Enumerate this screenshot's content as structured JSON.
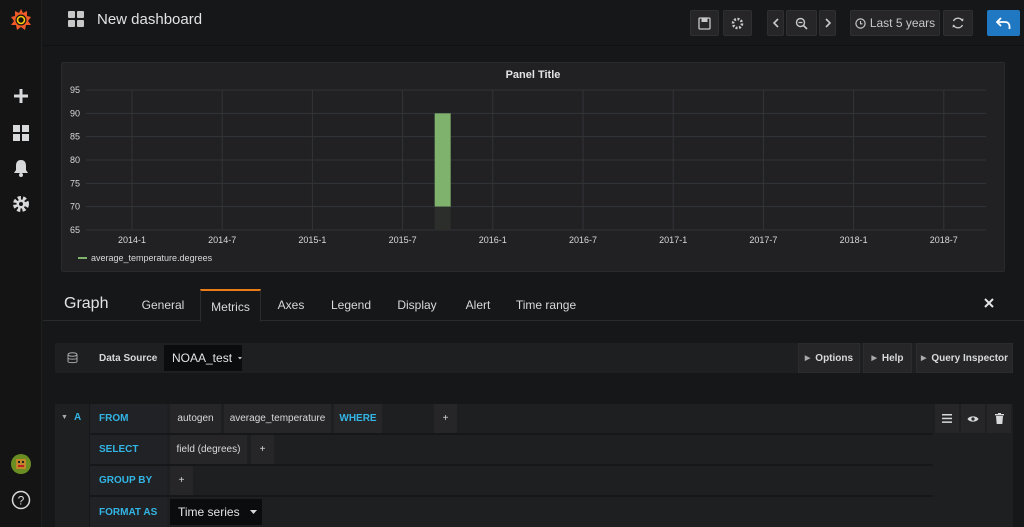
{
  "dashboard": {
    "title": "New dashboard"
  },
  "topbar": {
    "time_range": "Last 5 years"
  },
  "panel": {
    "title": "Panel Title",
    "legend": "average_temperature.degrees"
  },
  "chart_data": {
    "type": "bar",
    "title": "Panel Title",
    "x_ticks": [
      "2014-1",
      "2014-7",
      "2015-1",
      "2015-7",
      "2016-1",
      "2016-7",
      "2017-1",
      "2017-7",
      "2018-1",
      "2018-7"
    ],
    "y_ticks": [
      65,
      70,
      75,
      80,
      85,
      90,
      95
    ],
    "ylim": [
      65,
      95
    ],
    "series": [
      {
        "name": "average_temperature.degrees",
        "x": [
          "2015-09"
        ],
        "values": [
          90
        ]
      }
    ],
    "grid": true,
    "legend_position": "bottom-left",
    "series_color": "#7eb26d"
  },
  "editor": {
    "title": "Graph",
    "tabs": [
      "General",
      "Metrics",
      "Axes",
      "Legend",
      "Display",
      "Alert",
      "Time range"
    ],
    "active_tab": "Metrics"
  },
  "datasource": {
    "label": "Data Source",
    "value": "NOAA_test",
    "options_label": "Options",
    "help_label": "Help",
    "query_inspector_label": "Query Inspector"
  },
  "query": {
    "ref_id": "A",
    "from_kw": "FROM",
    "policy": "autogen",
    "measurement": "average_temperature",
    "where_kw": "WHERE",
    "select_kw": "SELECT",
    "field": "field (degrees)",
    "group_by_kw": "GROUP BY",
    "format_as_kw": "FORMAT AS",
    "format_value": "Time series",
    "plus": "+"
  },
  "colors": {
    "accent": "#eb7b18",
    "keyword": "#33b5e5",
    "primary_button": "#1f78c1",
    "series": "#7eb26d"
  }
}
